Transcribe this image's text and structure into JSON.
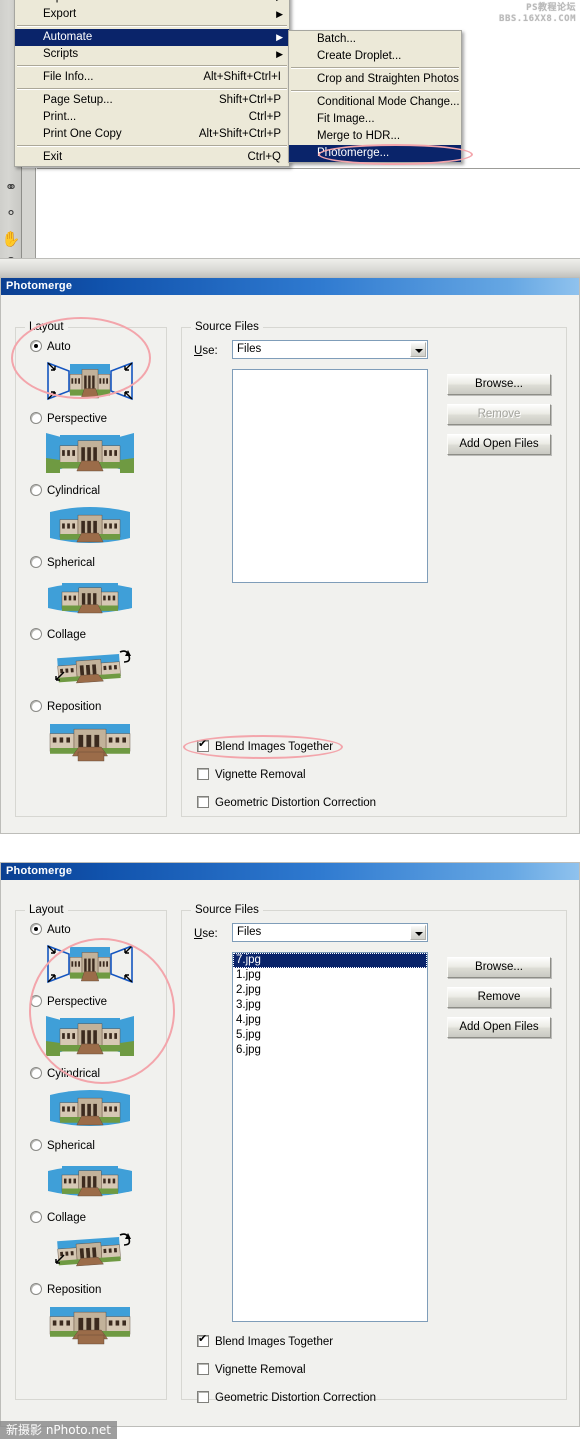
{
  "watermarks": {
    "top_line1": "PS教程论坛",
    "top_line2": "BBS.16XX8.COM",
    "bottom": "新摄影 nPhoto.net"
  },
  "menu": {
    "main_items": [
      {
        "label": "Import",
        "shortcut": "",
        "arrow": "▶",
        "sep_after": false,
        "selected": false
      },
      {
        "label": "Export",
        "shortcut": "",
        "arrow": "▶",
        "sep_after": true,
        "selected": false
      },
      {
        "label": "Automate",
        "shortcut": "",
        "arrow": "▶",
        "sep_after": false,
        "selected": true
      },
      {
        "label": "Scripts",
        "shortcut": "",
        "arrow": "▶",
        "sep_after": true,
        "selected": false
      },
      {
        "label": "File Info...",
        "shortcut": "Alt+Shift+Ctrl+I",
        "arrow": "",
        "sep_after": true,
        "selected": false
      },
      {
        "label": "Page Setup...",
        "shortcut": "Shift+Ctrl+P",
        "arrow": "",
        "sep_after": false,
        "selected": false
      },
      {
        "label": "Print...",
        "shortcut": "Ctrl+P",
        "arrow": "",
        "sep_after": false,
        "selected": false
      },
      {
        "label": "Print One Copy",
        "shortcut": "Alt+Shift+Ctrl+P",
        "arrow": "",
        "sep_after": true,
        "selected": false
      },
      {
        "label": "Exit",
        "shortcut": "Ctrl+Q",
        "arrow": "",
        "sep_after": false,
        "selected": false
      }
    ],
    "submenu_items": [
      {
        "label": "Batch...",
        "sep_after": false,
        "selected": false
      },
      {
        "label": "Create Droplet...",
        "sep_after": true,
        "selected": false
      },
      {
        "label": "Crop and Straighten Photos",
        "sep_after": true,
        "selected": false
      },
      {
        "label": "Conditional Mode Change...",
        "sep_after": false,
        "selected": false
      },
      {
        "label": "Fit Image...",
        "sep_after": false,
        "selected": false
      },
      {
        "label": "Merge to HDR...",
        "sep_after": false,
        "selected": false
      },
      {
        "label": "Photomerge...",
        "sep_after": false,
        "selected": true
      }
    ]
  },
  "dialog1": {
    "title": "Photomerge",
    "layout": {
      "group_label": "Layout",
      "options": [
        {
          "label": "Auto",
          "selected": true
        },
        {
          "label": "Perspective",
          "selected": false
        },
        {
          "label": "Cylindrical",
          "selected": false
        },
        {
          "label": "Spherical",
          "selected": false
        },
        {
          "label": "Collage",
          "selected": false
        },
        {
          "label": "Reposition",
          "selected": false
        }
      ]
    },
    "source": {
      "group_label": "Source Files",
      "use_label": "Use:",
      "use_value": "Files",
      "files": [],
      "buttons": [
        {
          "label": "Browse...",
          "disabled": false
        },
        {
          "label": "Remove",
          "disabled": true
        },
        {
          "label": "Add Open Files",
          "disabled": false
        }
      ]
    },
    "checkboxes": [
      {
        "label": "Blend Images Together",
        "checked": true
      },
      {
        "label": "Vignette Removal",
        "checked": false
      },
      {
        "label": "Geometric Distortion Correction",
        "checked": false
      }
    ]
  },
  "dialog2": {
    "title": "Photomerge",
    "layout": {
      "group_label": "Layout",
      "options": [
        {
          "label": "Auto",
          "selected": true
        },
        {
          "label": "Perspective",
          "selected": false
        },
        {
          "label": "Cylindrical",
          "selected": false
        },
        {
          "label": "Spherical",
          "selected": false
        },
        {
          "label": "Collage",
          "selected": false
        },
        {
          "label": "Reposition",
          "selected": false
        }
      ]
    },
    "source": {
      "group_label": "Source Files",
      "use_label": "Use:",
      "use_value": "Files",
      "files": [
        {
          "name": "7.jpg",
          "selected": true
        },
        {
          "name": "1.jpg",
          "selected": false
        },
        {
          "name": "2.jpg",
          "selected": false
        },
        {
          "name": "3.jpg",
          "selected": false
        },
        {
          "name": "4.jpg",
          "selected": false
        },
        {
          "name": "5.jpg",
          "selected": false
        },
        {
          "name": "6.jpg",
          "selected": false
        }
      ],
      "buttons": [
        {
          "label": "Browse...",
          "disabled": false
        },
        {
          "label": "Remove",
          "disabled": false
        },
        {
          "label": "Add Open Files",
          "disabled": false
        }
      ]
    },
    "checkboxes": [
      {
        "label": "Blend Images Together",
        "checked": true
      },
      {
        "label": "Vignette Removal",
        "checked": false
      },
      {
        "label": "Geometric Distortion Correction",
        "checked": false
      }
    ]
  },
  "colors": {
    "menu_highlight": "#0a246a",
    "titlebar_start": "#0b3f91",
    "titlebar_end": "#8fc2ee",
    "dialog_bg": "#f1f1ee",
    "annotation_red": "#f3a5ab"
  },
  "toolbar_icons": [
    "dodge-tool-icon",
    "burn-tool-icon",
    "hand-tool-icon",
    "zoom-tool-icon"
  ]
}
